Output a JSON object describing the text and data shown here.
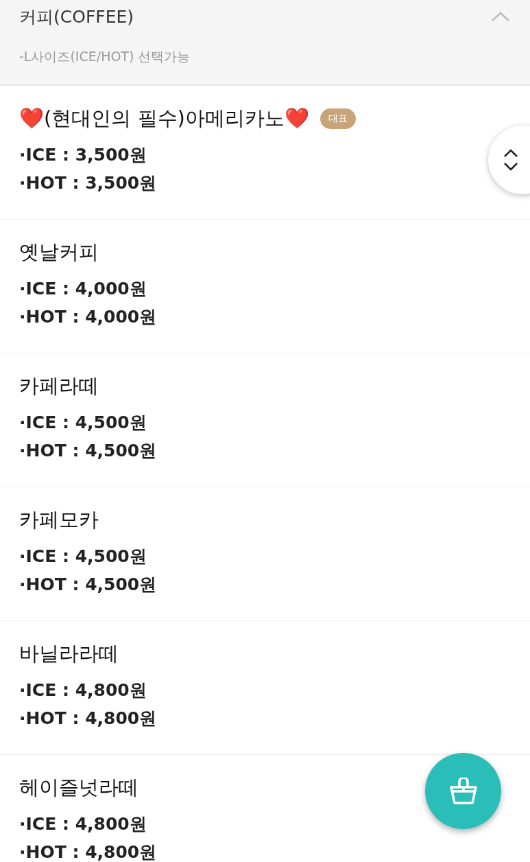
{
  "category": {
    "title": "커피(COFFEE)",
    "note": "-L사이즈(ICE/HOT) 선택가능",
    "expanded": true
  },
  "items": [
    {
      "name": "❤️(현대인의 필수)아메리카노❤️",
      "badge": "대표",
      "prices": [
        "·ICE : 3,500원",
        "·HOT : 3,500원"
      ]
    },
    {
      "name": "옛날커피",
      "prices": [
        "·ICE : 4,000원",
        "·HOT : 4,000원"
      ]
    },
    {
      "name": "카페라떼",
      "prices": [
        "·ICE : 4,500원",
        "·HOT : 4,500원"
      ]
    },
    {
      "name": "카페모카",
      "prices": [
        "·ICE : 4,500원",
        "·HOT : 4,500원"
      ]
    },
    {
      "name": "바닐라라떼",
      "prices": [
        "·ICE : 4,800원",
        "·HOT : 4,800원"
      ]
    },
    {
      "name": "헤이즐넛라떼",
      "prices": [
        "·ICE : 4,800원",
        "·HOT : 4,800원"
      ]
    }
  ]
}
